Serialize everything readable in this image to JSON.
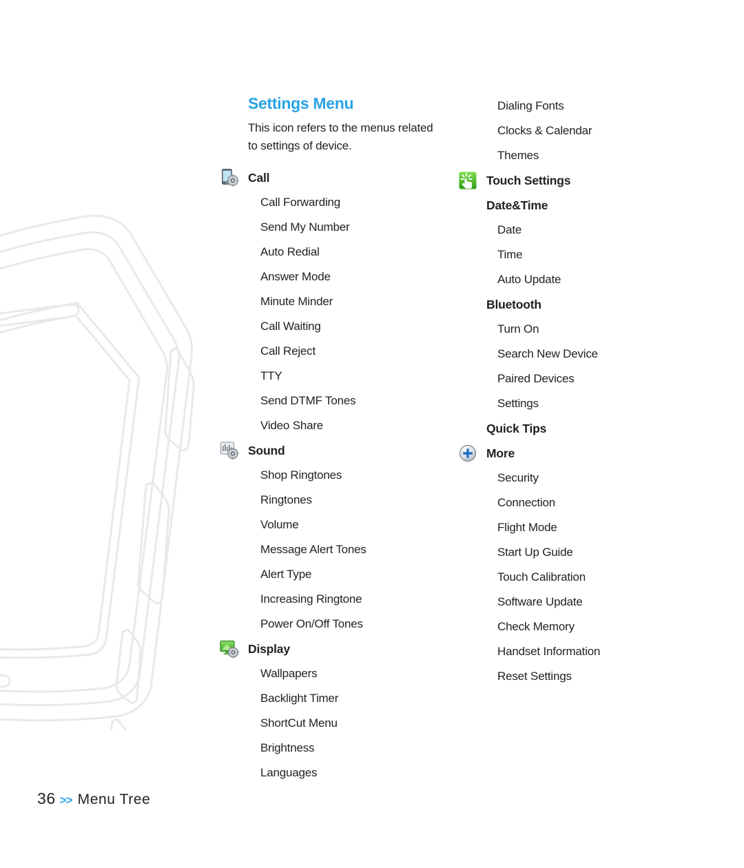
{
  "page": {
    "number": "36",
    "chevron": ">>",
    "footer_label": "Menu Tree"
  },
  "section": {
    "title": "Settings Menu",
    "description": "This icon refers to the menus related to settings of device."
  },
  "colors": {
    "accent": "#29a3e8",
    "text": "#231f20",
    "watermark": "#e9e9e9"
  },
  "left_column": [
    {
      "type": "head",
      "label": "Call",
      "icon": "phone-settings-icon"
    },
    {
      "type": "item",
      "label": "Call Forwarding"
    },
    {
      "type": "item",
      "label": "Send My Number"
    },
    {
      "type": "item",
      "label": "Auto Redial"
    },
    {
      "type": "item",
      "label": "Answer Mode"
    },
    {
      "type": "item",
      "label": "Minute Minder"
    },
    {
      "type": "item",
      "label": "Call Waiting"
    },
    {
      "type": "item",
      "label": "Call Reject"
    },
    {
      "type": "item",
      "label": "TTY"
    },
    {
      "type": "item",
      "label": "Send DTMF Tones"
    },
    {
      "type": "item",
      "label": "Video Share"
    },
    {
      "type": "head",
      "label": "Sound",
      "icon": "sound-settings-icon"
    },
    {
      "type": "item",
      "label": "Shop Ringtones"
    },
    {
      "type": "item",
      "label": "Ringtones"
    },
    {
      "type": "item",
      "label": "Volume"
    },
    {
      "type": "item",
      "label": "Message Alert Tones"
    },
    {
      "type": "item",
      "label": "Alert Type"
    },
    {
      "type": "item",
      "label": "Increasing Ringtone"
    },
    {
      "type": "item",
      "label": "Power On/Off Tones"
    },
    {
      "type": "head",
      "label": "Display",
      "icon": "display-settings-icon"
    },
    {
      "type": "item",
      "label": "Wallpapers"
    },
    {
      "type": "item",
      "label": "Backlight Timer"
    },
    {
      "type": "item",
      "label": "ShortCut Menu"
    },
    {
      "type": "item",
      "label": "Brightness"
    },
    {
      "type": "item",
      "label": "Languages"
    }
  ],
  "right_column": [
    {
      "type": "item",
      "label": "Dialing Fonts"
    },
    {
      "type": "item",
      "label": "Clocks & Calendar"
    },
    {
      "type": "item",
      "label": "Themes"
    },
    {
      "type": "head",
      "label": "Touch Settings",
      "icon": "touch-settings-icon"
    },
    {
      "type": "subhead",
      "label": "Date&Time"
    },
    {
      "type": "item",
      "label": "Date"
    },
    {
      "type": "item",
      "label": "Time"
    },
    {
      "type": "item",
      "label": "Auto Update"
    },
    {
      "type": "subhead",
      "label": "Bluetooth"
    },
    {
      "type": "item",
      "label": "Turn On"
    },
    {
      "type": "item",
      "label": "Search New Device"
    },
    {
      "type": "item",
      "label": "Paired Devices"
    },
    {
      "type": "item",
      "label": "Settings"
    },
    {
      "type": "subhead",
      "label": "Quick Tips"
    },
    {
      "type": "head",
      "label": "More",
      "icon": "plus-circle-icon"
    },
    {
      "type": "item",
      "label": "Security"
    },
    {
      "type": "item",
      "label": "Connection"
    },
    {
      "type": "item",
      "label": "Flight Mode"
    },
    {
      "type": "item",
      "label": "Start Up Guide"
    },
    {
      "type": "item",
      "label": "Touch Calibration"
    },
    {
      "type": "item",
      "label": "Software Update"
    },
    {
      "type": "item",
      "label": "Check Memory"
    },
    {
      "type": "item",
      "label": "Handset Information"
    },
    {
      "type": "item",
      "label": "Reset Settings"
    }
  ]
}
